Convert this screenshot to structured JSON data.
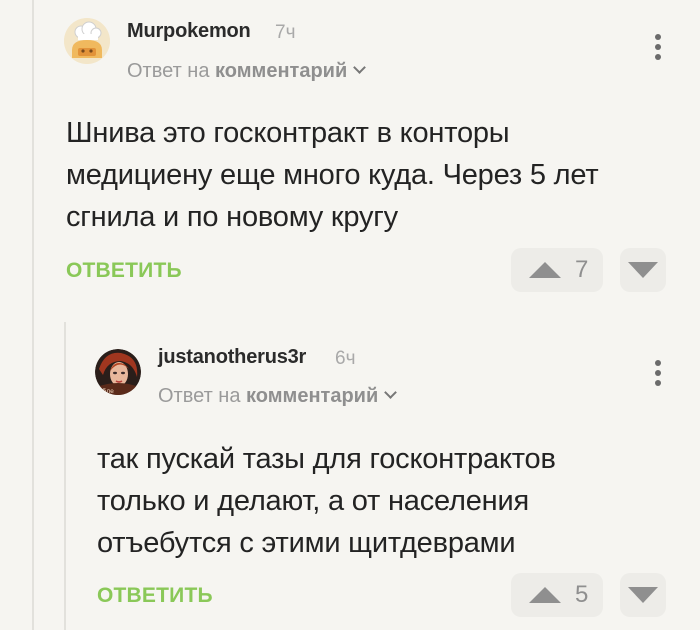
{
  "comments": [
    {
      "author": "Murpokemon",
      "time": "7ч",
      "reply_prefix": "Ответ на",
      "reply_target": "комментарий",
      "text": [
        "Шнива это госконтракт в конторы",
        "медициену еще много куда. Через 5 лет",
        "сгнила и по новому кругу"
      ],
      "reply_label": "ОТВЕТИТЬ",
      "rating": "7",
      "avatar_icon": "chef-avatar-icon"
    },
    {
      "author": "justanotherus3r",
      "time": "6ч",
      "reply_prefix": "Ответ на",
      "reply_target": "комментарий",
      "text": [
        "так пускай тазы для госконтрактов",
        "только и делают, а от населения",
        "отъебутся с этими щитдеврами"
      ],
      "reply_label": "ОТВЕТИТЬ",
      "rating": "5",
      "avatar_icon": "woman-portrait-avatar-icon"
    }
  ],
  "colors": {
    "background": "#f6f5f1",
    "reply_button": "#8ac858",
    "vote_box": "#edece8",
    "muted_text": "#9a9a9a"
  }
}
